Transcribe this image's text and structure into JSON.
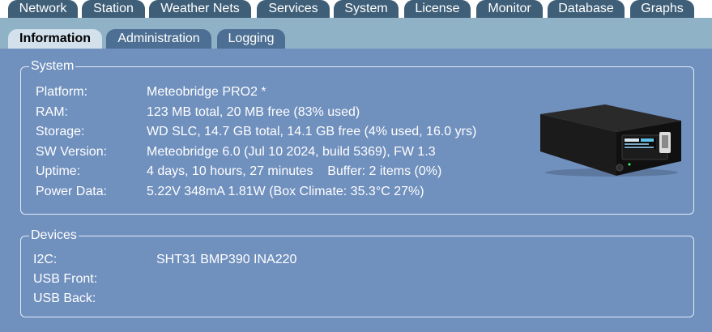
{
  "top_tabs": [
    "Network",
    "Station",
    "Weather Nets",
    "Services",
    "System",
    "License",
    "Monitor",
    "Database",
    "Graphs"
  ],
  "sub_tabs": [
    "Information",
    "Administration",
    "Logging"
  ],
  "system": {
    "legend": "System",
    "labels": [
      "Platform:",
      "RAM:",
      "Storage:",
      "SW Version:",
      "Uptime:",
      "Power Data:"
    ],
    "values": [
      "Meteobridge PRO2 *",
      "123 MB total, 20 MB free (83% used)",
      "WD SLC, 14.7 GB total, 14.1 GB free (4% used, 16.0 yrs)",
      "Meteobridge 6.0 (Jul 10 2024, build 5369), FW 1.3",
      "4 days, 10 hours, 27 minutes    Buffer: 2 items (0%)",
      "5.22V 348mA 1.81W (Box Climate: 35.3°C 27%)"
    ]
  },
  "devices": {
    "legend": "Devices",
    "labels": [
      "I2C:",
      "USB Front:",
      "USB Back:"
    ],
    "values": [
      "SHT31 BMP390 INA220",
      "",
      ""
    ]
  },
  "colors": {
    "top_tab_bg": "#3f5f78",
    "sub_tab_bg": "#4d6f93",
    "sub_tab_active_bg": "#d2e1ec",
    "subbar_bg": "#8fb2c7",
    "content_bg": "#7090be"
  },
  "device_image": "meteobridge-pro2-device-image"
}
